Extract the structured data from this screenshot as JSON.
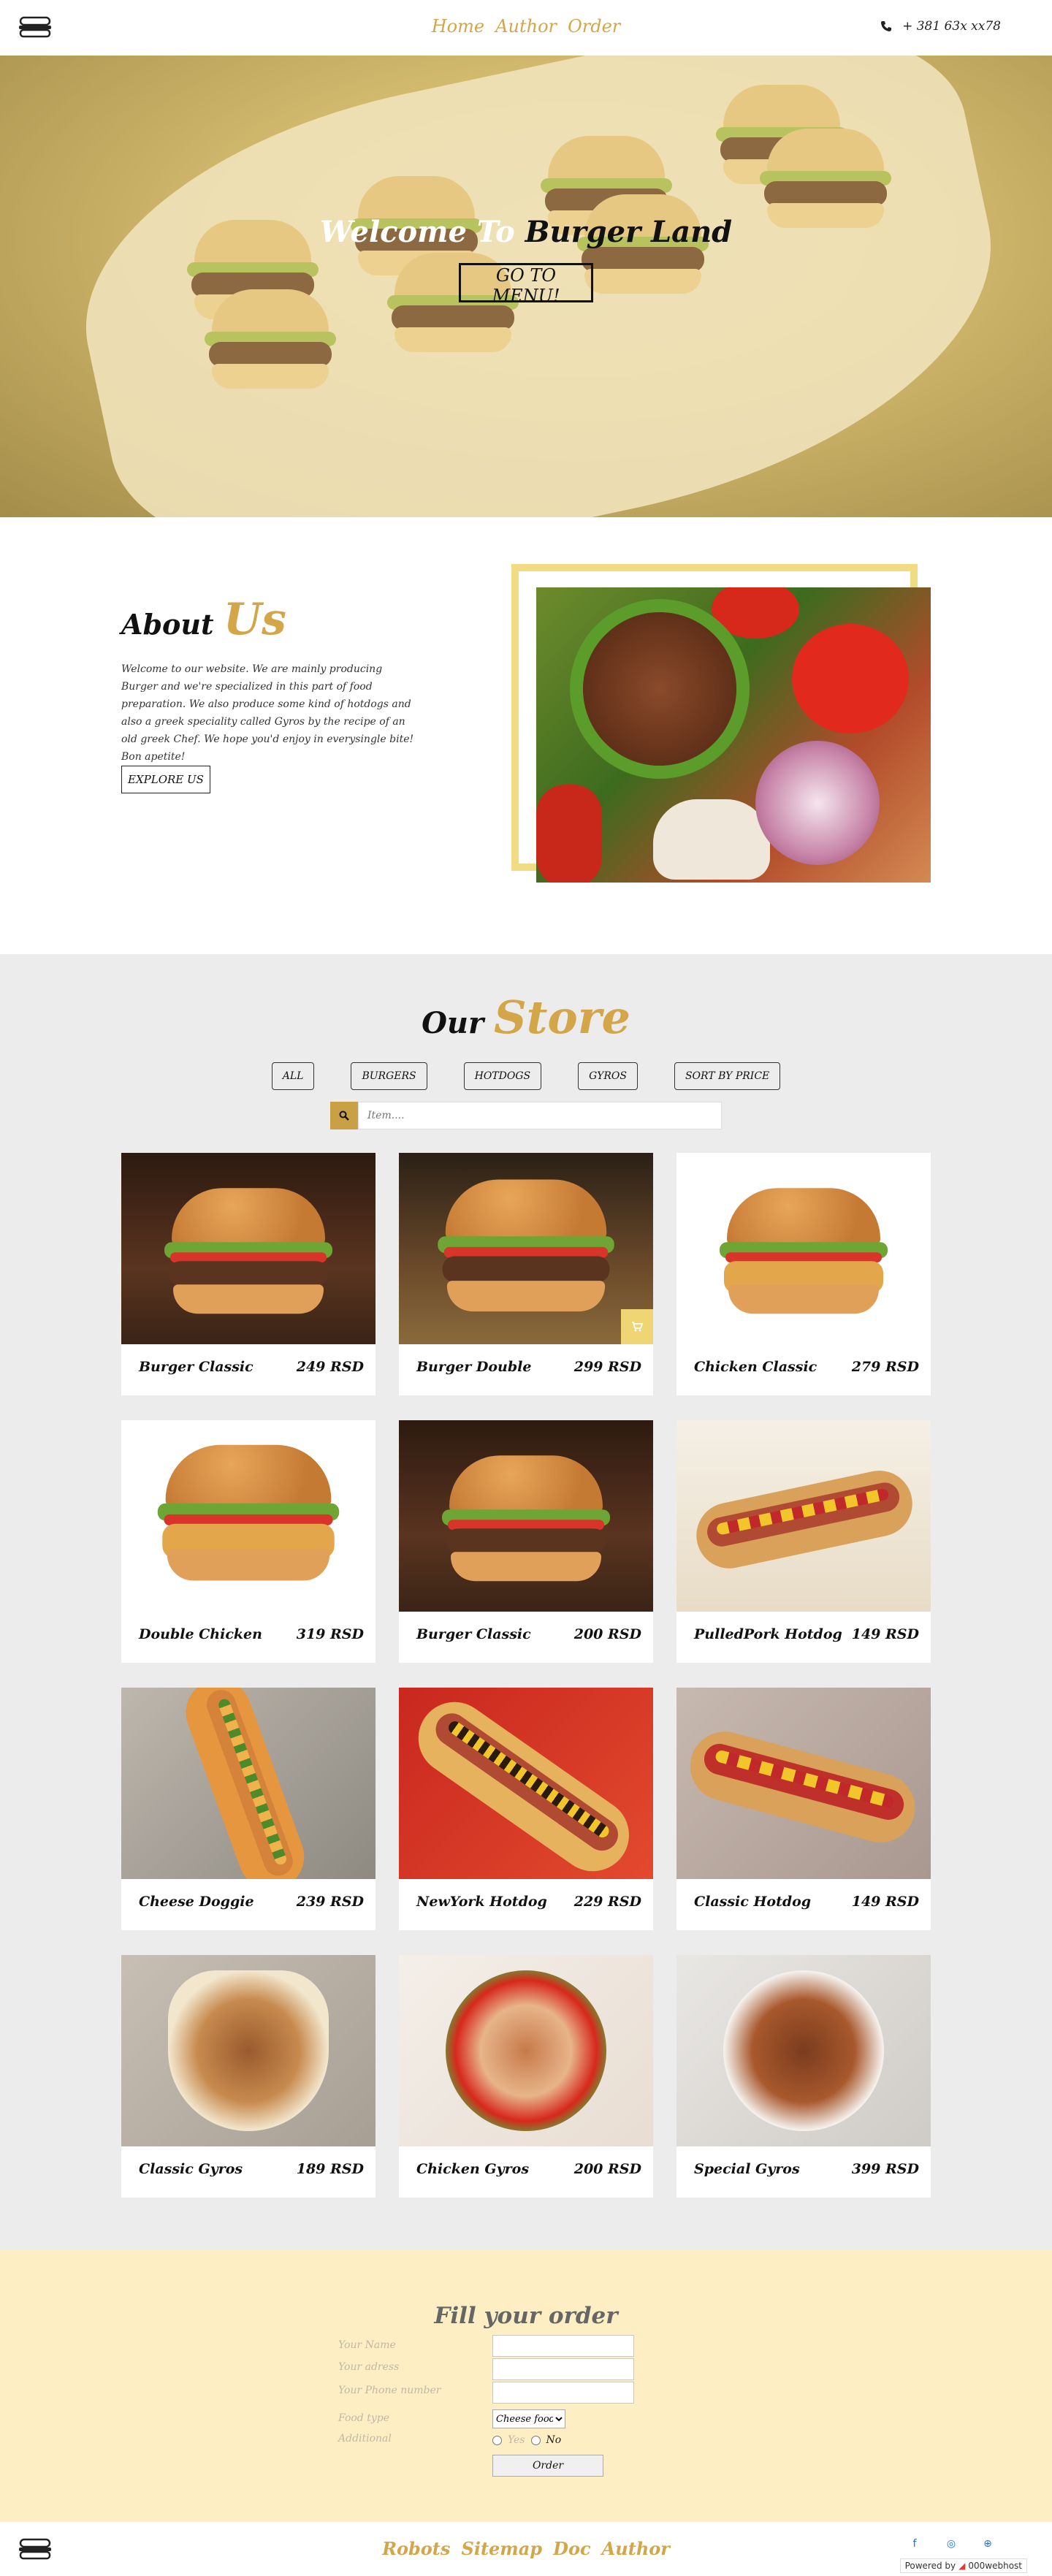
{
  "nav": {
    "links": [
      "Home",
      "Author",
      "Order"
    ],
    "phone": "+ 381 63x xx78"
  },
  "hero": {
    "title_a": "Welcome To ",
    "title_b": "Burger Land",
    "cta": "GO TO MENU!"
  },
  "about": {
    "title_a": "About ",
    "title_b": "Us",
    "text": "Welcome to our website. We are mainly producing Burger and we're specialized in this part of food preparation. We also produce some kind of hotdogs and also a greek speciality called Gyros by the recipe of an old greek Chef. We hope you'd enjoy in everysingle bite! Bon apetite!",
    "button": "EXPLORE US"
  },
  "store": {
    "title_a": "Our ",
    "title_b": "Store",
    "filters": [
      "ALL",
      "BURGERS",
      "HOTDOGS",
      "GYROS",
      "SORT BY PRICE"
    ],
    "search_placeholder": "Item....",
    "items": [
      {
        "name": "Burger Classic",
        "price": "249 RSD"
      },
      {
        "name": "Burger Double",
        "price": "299 RSD"
      },
      {
        "name": "Chicken Classic",
        "price": "279 RSD"
      },
      {
        "name": "Double Chicken",
        "price": "319 RSD"
      },
      {
        "name": "Burger Classic",
        "price": "200 RSD"
      },
      {
        "name": "PulledPork Hotdog",
        "price": "149 RSD"
      },
      {
        "name": "Cheese Doggie",
        "price": "239 RSD"
      },
      {
        "name": "NewYork Hotdog",
        "price": "229 RSD"
      },
      {
        "name": "Classic Hotdog",
        "price": "149 RSD"
      },
      {
        "name": "Classic Gyros",
        "price": "189 RSD"
      },
      {
        "name": "Chicken Gyros",
        "price": "200 RSD"
      },
      {
        "name": "Special Gyros",
        "price": "399 RSD"
      }
    ]
  },
  "order": {
    "title": "Fill your order",
    "labels": [
      "Your Name",
      "Your adress",
      "Your Phone number",
      "Food type",
      "Additional"
    ],
    "food_type_selected": "Cheese food",
    "radio_yes": "Yes",
    "radio_no": "No",
    "submit": "Order"
  },
  "footer": {
    "links": [
      "Robots",
      "Sitemap",
      "Doc",
      "Author"
    ],
    "powered_by": "Powered by",
    "host": "000webhost"
  },
  "colors": {
    "accent": "#d3a64a",
    "store_bg": "#ececec",
    "order_bg": "#fdeec4",
    "cart_badge": "#f0d575"
  }
}
